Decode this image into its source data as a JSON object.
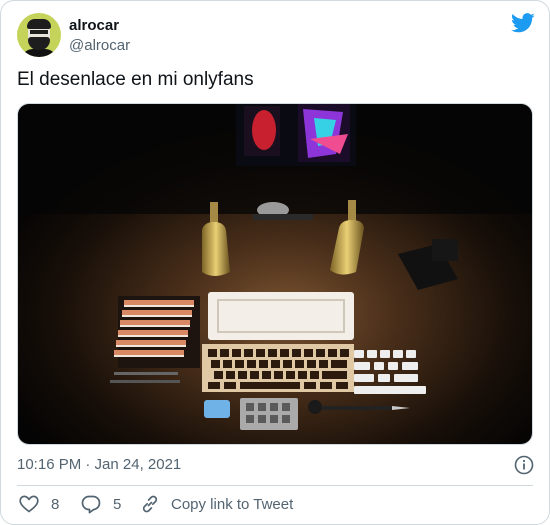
{
  "tweet": {
    "display_name": "alrocar",
    "handle": "@alrocar",
    "text": "El desenlace en mi onlyfans",
    "timestamp": "10:16 PM · Jan 24, 2021"
  },
  "actions": {
    "likes": "8",
    "replies": "5",
    "copy_link": "Copy link to Tweet"
  },
  "icons": [
    "twitter-bird-icon",
    "info-icon",
    "heart-icon",
    "reply-icon",
    "link-icon"
  ],
  "colors": {
    "brand": "#1d9bf0",
    "secondary_text": "#536471",
    "border": "#cfd9de"
  }
}
